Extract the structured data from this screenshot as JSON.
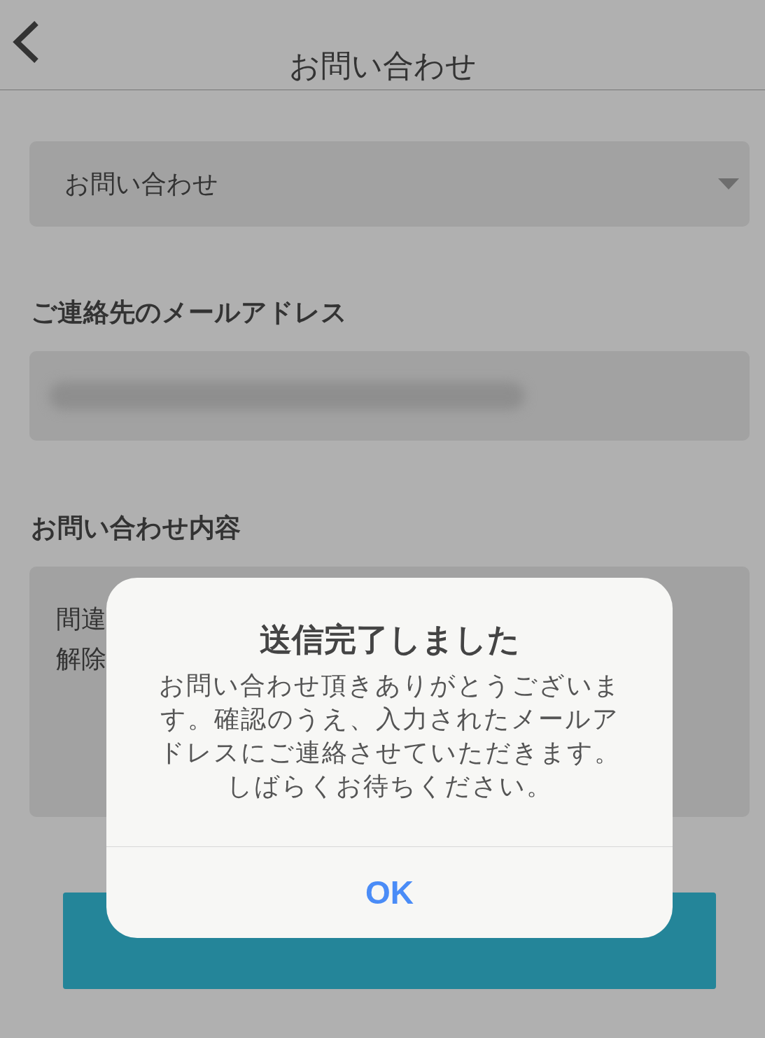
{
  "header": {
    "title": "お問い合わせ"
  },
  "category_select": {
    "value": "お問い合わせ"
  },
  "email": {
    "label": "ご連絡先のメールアドレス"
  },
  "content": {
    "label": "お問い合わせ内容",
    "lines": [
      "間違",
      "解除"
    ]
  },
  "dialog": {
    "title": "送信完了しました",
    "message": "お問い合わせ頂きありがとうございます。確認のうえ、入力されたメールアドレスにご連絡させていただきます。しばらくお待ちください。",
    "button": "OK"
  }
}
